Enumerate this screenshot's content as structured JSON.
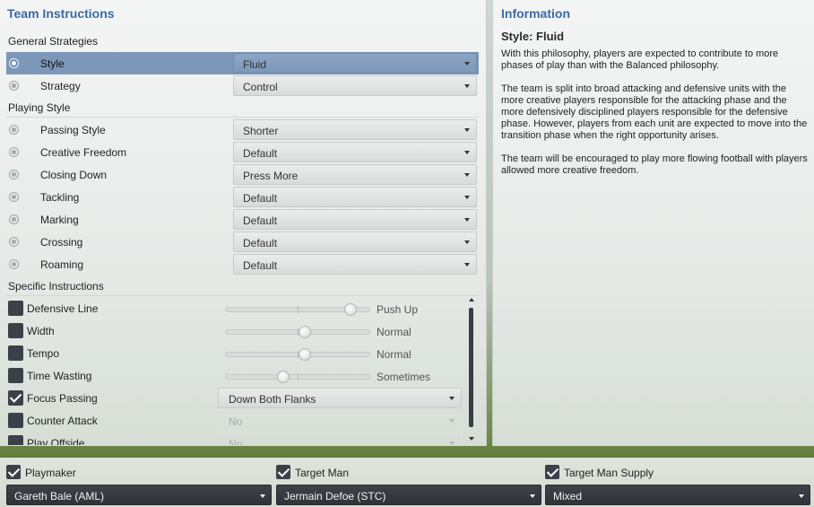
{
  "team_instructions": {
    "title": "Team Instructions",
    "general_header": "General Strategies",
    "general": [
      {
        "label": "Style",
        "value": "Fluid",
        "selected": true
      },
      {
        "label": "Strategy",
        "value": "Control",
        "selected": false
      }
    ],
    "playing_header": "Playing Style",
    "playing": [
      {
        "label": "Passing Style",
        "value": "Shorter"
      },
      {
        "label": "Creative Freedom",
        "value": "Default"
      },
      {
        "label": "Closing Down",
        "value": "Press More"
      },
      {
        "label": "Tackling",
        "value": "Default"
      },
      {
        "label": "Marking",
        "value": "Default"
      },
      {
        "label": "Crossing",
        "value": "Default"
      },
      {
        "label": "Roaming",
        "value": "Default"
      }
    ],
    "specific_header": "Specific Instructions",
    "specific": [
      {
        "label": "Defensive Line",
        "checked": false,
        "kind": "slider",
        "value_text": "Push Up",
        "level": 0.87
      },
      {
        "label": "Width",
        "checked": false,
        "kind": "slider",
        "value_text": "Normal",
        "level": 0.55
      },
      {
        "label": "Tempo",
        "checked": false,
        "kind": "slider",
        "value_text": "Normal",
        "level": 0.55
      },
      {
        "label": "Time Wasting",
        "checked": false,
        "kind": "slider",
        "value_text": "Sometimes",
        "level": 0.4
      },
      {
        "label": "Focus Passing",
        "checked": true,
        "kind": "dropdown",
        "value_text": "Down Both Flanks",
        "disabled": false
      },
      {
        "label": "Counter Attack",
        "checked": false,
        "kind": "dropdown",
        "value_text": "No",
        "disabled": true
      },
      {
        "label": "Play Offside",
        "checked": false,
        "kind": "dropdown",
        "value_text": "No",
        "disabled": true
      }
    ]
  },
  "information": {
    "title": "Information",
    "subtitle": "Style: Fluid",
    "paragraphs": [
      "With this philosophy, players are expected to contribute to more phases of play than with the Balanced philosophy.",
      "The team is split into broad attacking and defensive units with the more creative players responsible for the attacking phase and the more defensively disciplined players responsible for the defensive phase. However, players from each unit are expected to move into the transition phase when the right opportunity arises.",
      "The team will be encouraged to play more flowing football with players allowed more creative freedom."
    ]
  },
  "bottom_bar": [
    {
      "label": "Playmaker",
      "checked": true,
      "value": "Gareth Bale (AML)"
    },
    {
      "label": "Target Man",
      "checked": true,
      "value": "Jermain Defoe (STC)"
    },
    {
      "label": "Target Man Supply",
      "checked": true,
      "value": "Mixed"
    }
  ],
  "colors": {
    "title_blue": "#3b69a3",
    "selected_row": "#7d97b9",
    "checkbox_dark": "#3c4048"
  }
}
